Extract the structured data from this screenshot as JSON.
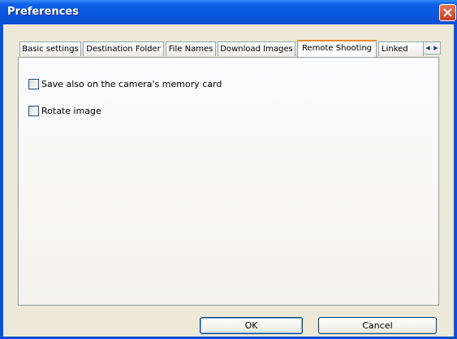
{
  "window": {
    "title": "Preferences",
    "close_icon": "close-icon",
    "title_color": "#0a56de",
    "close_color": "#d2552e"
  },
  "tabs": [
    {
      "label": "Basic settings",
      "active": false
    },
    {
      "label": "Destination Folder",
      "active": false
    },
    {
      "label": "File Names",
      "active": false
    },
    {
      "label": "Download Images",
      "active": false
    },
    {
      "label": "Remote Shooting",
      "active": true
    },
    {
      "label": "Linked",
      "active": false
    }
  ],
  "tab_scroll": {
    "left_icon": "chevron-left-icon",
    "right_icon": "chevron-right-icon"
  },
  "options": [
    {
      "label": "Save also on the camera's memory card",
      "checked": false
    },
    {
      "label": "Rotate image",
      "checked": false
    }
  ],
  "buttons": {
    "ok": "OK",
    "cancel": "Cancel"
  }
}
